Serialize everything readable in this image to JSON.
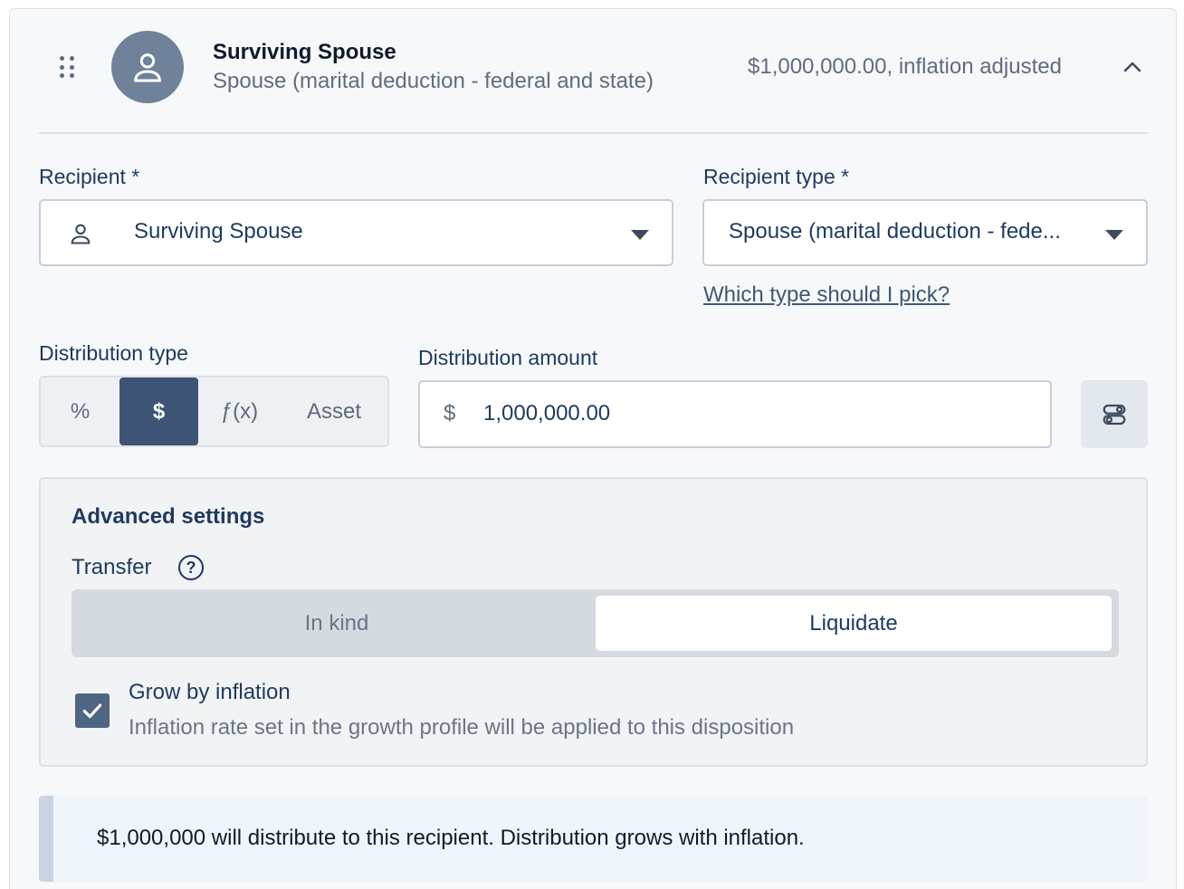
{
  "header": {
    "name": "Surviving Spouse",
    "type": "Spouse (marital deduction - federal and state)",
    "amount_summary": "$1,000,000.00, inflation adjusted"
  },
  "recipient": {
    "label": "Recipient *",
    "value": "Surviving Spouse"
  },
  "recipient_type": {
    "label": "Recipient type *",
    "value": "Spouse (marital deduction - fede...",
    "help_link": "Which type should I pick?"
  },
  "distribution_type": {
    "label": "Distribution type",
    "options": [
      "%",
      "$",
      "ƒ(x)",
      "Asset"
    ],
    "selected": "$"
  },
  "distribution_amount": {
    "label": "Distribution amount",
    "currency": "$",
    "value": "1,000,000.00"
  },
  "advanced": {
    "title": "Advanced settings",
    "transfer_label": "Transfer",
    "transfer_options": [
      "In kind",
      "Liquidate"
    ],
    "transfer_selected": "Liquidate",
    "grow_title": "Grow by inflation",
    "grow_desc": "Inflation rate set in the growth profile will be applied to this disposition",
    "grow_checked": true
  },
  "banner": {
    "text": "$1,000,000 will distribute to this recipient. Distribution grows with inflation."
  },
  "colors": {
    "accent": "#3d5475",
    "avatar": "#6f8299",
    "banner_bg": "#f0f5fc"
  }
}
